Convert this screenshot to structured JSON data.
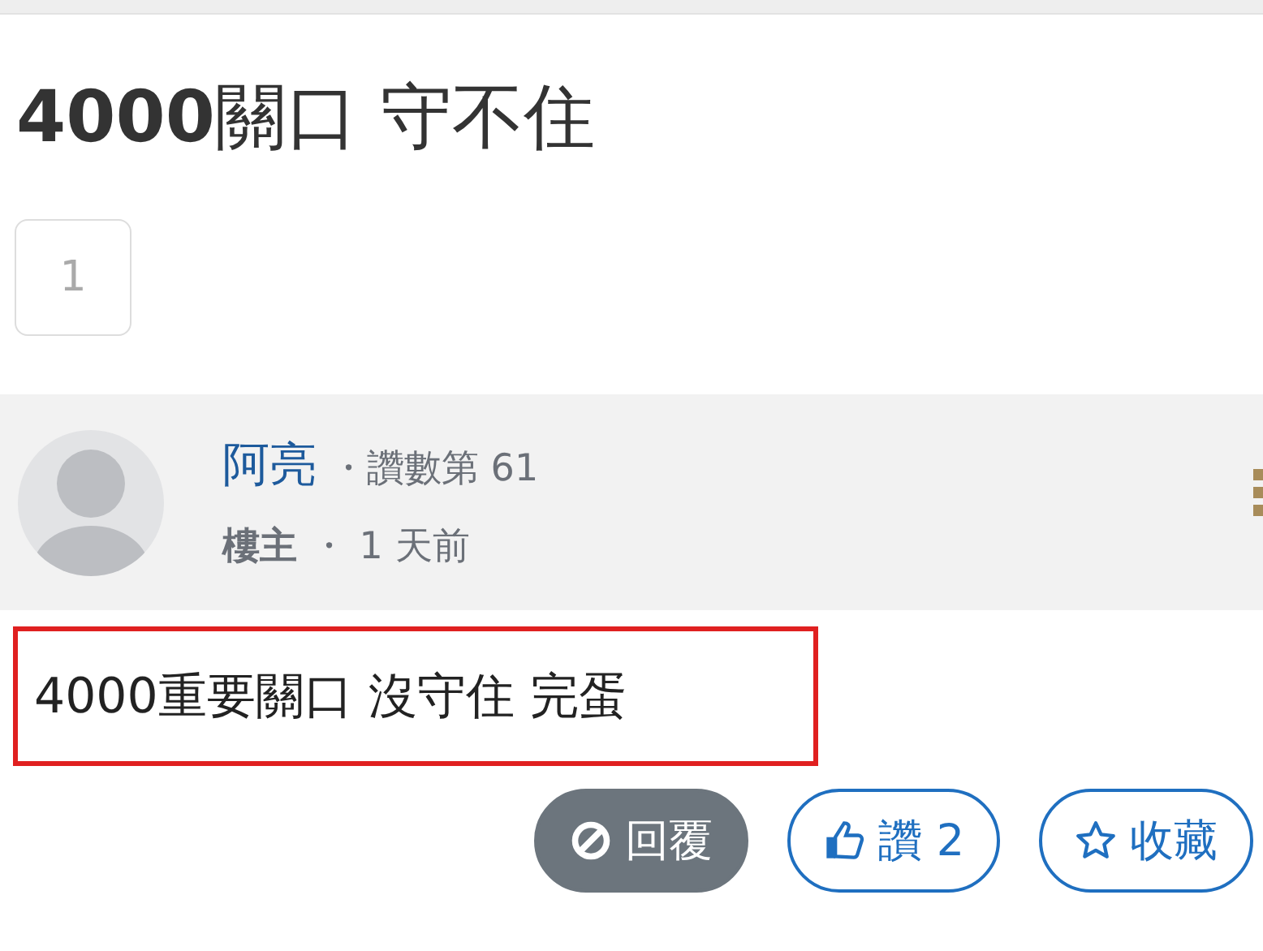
{
  "title": "**4000**關口 守不住",
  "pages": [
    "1"
  ],
  "post": {
    "author": "阿亮",
    "rank": "・讚數第 61",
    "role": "樓主",
    "time": "・ 1 天前",
    "content": "4000重要關口 沒守住 完蛋",
    "highlighted": true,
    "actions": [
      {
        "kind": "reply",
        "label": "回覆",
        "disabled": true
      },
      {
        "kind": "like",
        "label": "讚 2",
        "disabled": false
      },
      {
        "kind": "favorite",
        "label": "收藏",
        "disabled": false
      }
    ]
  }
}
